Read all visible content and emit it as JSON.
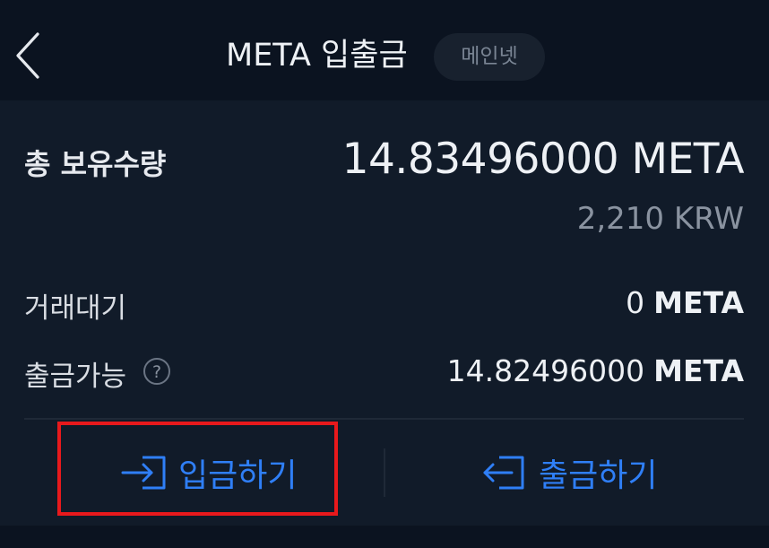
{
  "header": {
    "title": "META 입출금",
    "network_badge": "메인넷",
    "back_icon": "chevron-left-icon"
  },
  "balance": {
    "total_label": "총 보유수량",
    "total_amount": "14.83496000 META",
    "total_krw": "2,210 KRW"
  },
  "rows": [
    {
      "label": "거래대기",
      "amount": "0",
      "unit": "META"
    },
    {
      "label": "출금가능",
      "amount": "14.82496000",
      "unit": "META",
      "help_icon": "question-circle-icon"
    }
  ],
  "actions": {
    "deposit_label": "입금하기",
    "deposit_icon": "sign-in-icon",
    "withdraw_label": "출금하기",
    "withdraw_icon": "sign-out-icon"
  },
  "colors": {
    "background": "#0d1624",
    "card": "#111b29",
    "accent": "#2f7ff7",
    "highlight": "#e8191c"
  }
}
